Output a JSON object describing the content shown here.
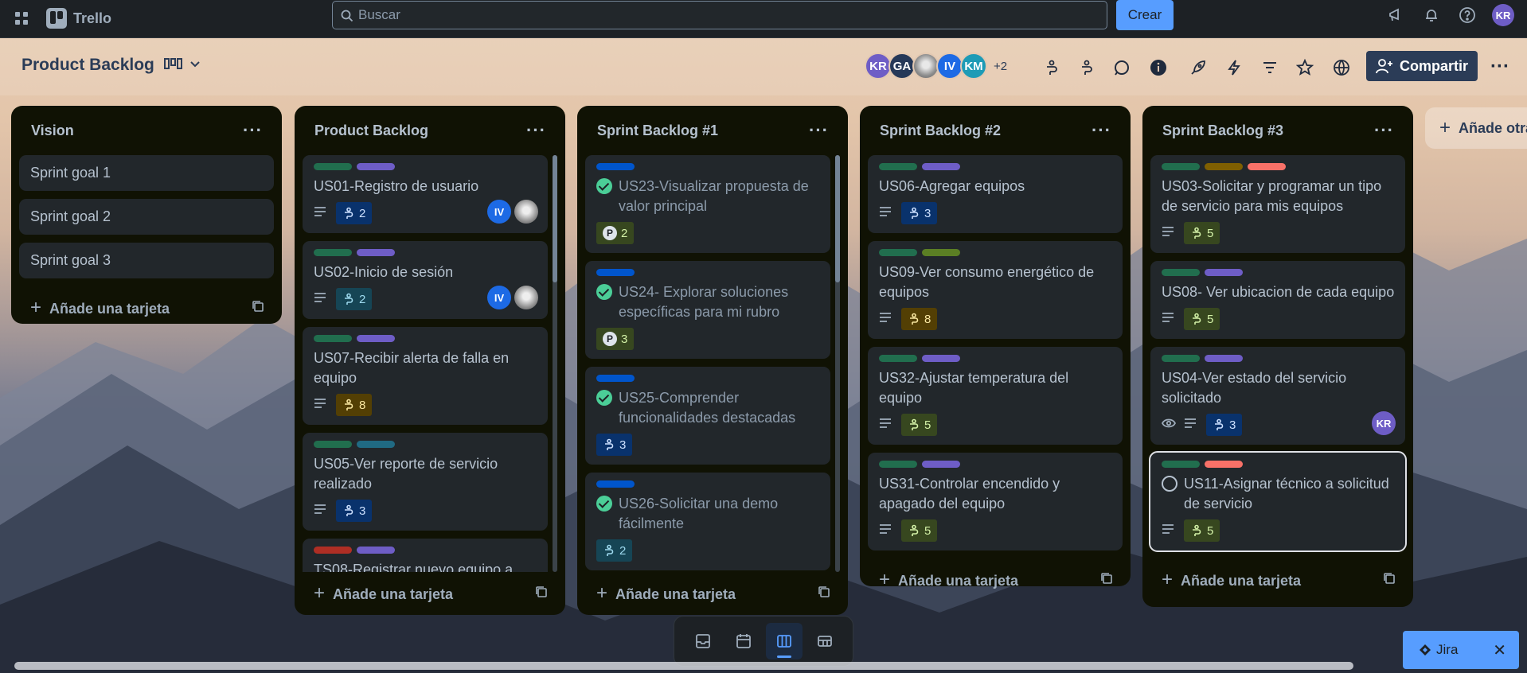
{
  "topbar": {
    "app_name": "Trello",
    "search_placeholder": "Buscar",
    "create_label": "Crear",
    "user_initials": "KR"
  },
  "board": {
    "title": "Product Backlog",
    "members": [
      {
        "initials": "KR",
        "color": "#6e5dc6"
      },
      {
        "initials": "GA",
        "color": "#253858"
      },
      {
        "initials": "",
        "color": "#9aa0a6"
      },
      {
        "initials": "IV",
        "color": "#1d6ae5"
      },
      {
        "initials": "KM",
        "color": "#1d9bb6"
      }
    ],
    "more_members": "+2",
    "share_label": "Compartir"
  },
  "lists": [
    {
      "title": "Vision",
      "add_label": "Añade una tarjeta",
      "simple_cards": [
        "Sprint goal 1",
        "Sprint goal 2",
        "Sprint goal 3"
      ]
    },
    {
      "title": "Product Backlog",
      "add_label": "Añade una tarjeta",
      "cards": [
        {
          "title": "US01-Registro de usuario",
          "points": "2"
        },
        {
          "title": "US02-Inicio de sesión",
          "points": "2"
        },
        {
          "title": "US07-Recibir alerta de falla en equipo",
          "points": "8"
        },
        {
          "title": "US05-Ver reporte de servicio realizado",
          "points": "3"
        },
        {
          "title": "TS08-Registrar nuevo equipo a"
        }
      ]
    },
    {
      "title": "Sprint Backlog #1",
      "add_label": "Añade una tarjeta",
      "cards": [
        {
          "title": "US23-Visualizar propuesta de valor principal",
          "points": "2"
        },
        {
          "title": "US24- Explorar soluciones específicas para mi rubro",
          "points": "3"
        },
        {
          "title": "US25-Comprender funcionalidades destacadas",
          "points": "3"
        },
        {
          "title": "US26-Solicitar una demo fácilmente",
          "points": "2"
        }
      ]
    },
    {
      "title": "Sprint Backlog #2",
      "add_label": "Añade una tarjeta",
      "cards": [
        {
          "title": "US06-Agregar equipos",
          "points": "3"
        },
        {
          "title": "US09-Ver consumo energético de equipos",
          "points": "8"
        },
        {
          "title": "US32-Ajustar temperatura del equipo",
          "points": "5"
        },
        {
          "title": "US31-Controlar encendido y apagado del equipo",
          "points": "5"
        }
      ]
    },
    {
      "title": "Sprint Backlog #3",
      "add_label": "Añade una tarjeta",
      "cards": [
        {
          "title": "US03-Solicitar y programar un tipo de servicio para mis equipos",
          "points": "5"
        },
        {
          "title": "US08- Ver ubicacion de cada equipo",
          "points": "5"
        },
        {
          "title": "US04-Ver estado del servicio solicitado",
          "points": "3",
          "member": "KR"
        },
        {
          "title": "US11-Asignar técnico a solicitud de servicio",
          "points": "5"
        }
      ]
    }
  ],
  "card_members": {
    "iv": "IV"
  },
  "add_list_label": "Añade otra lista",
  "jira_label": "Jira",
  "label_colors": {
    "green": "#216e4e",
    "purple": "#6e5dc6",
    "teal": "#206a83",
    "red": "#ae2e24",
    "blue": "#0055cc",
    "olive": "#5b7f24",
    "yellow": "#7f5f01",
    "pink": "#f87168"
  }
}
